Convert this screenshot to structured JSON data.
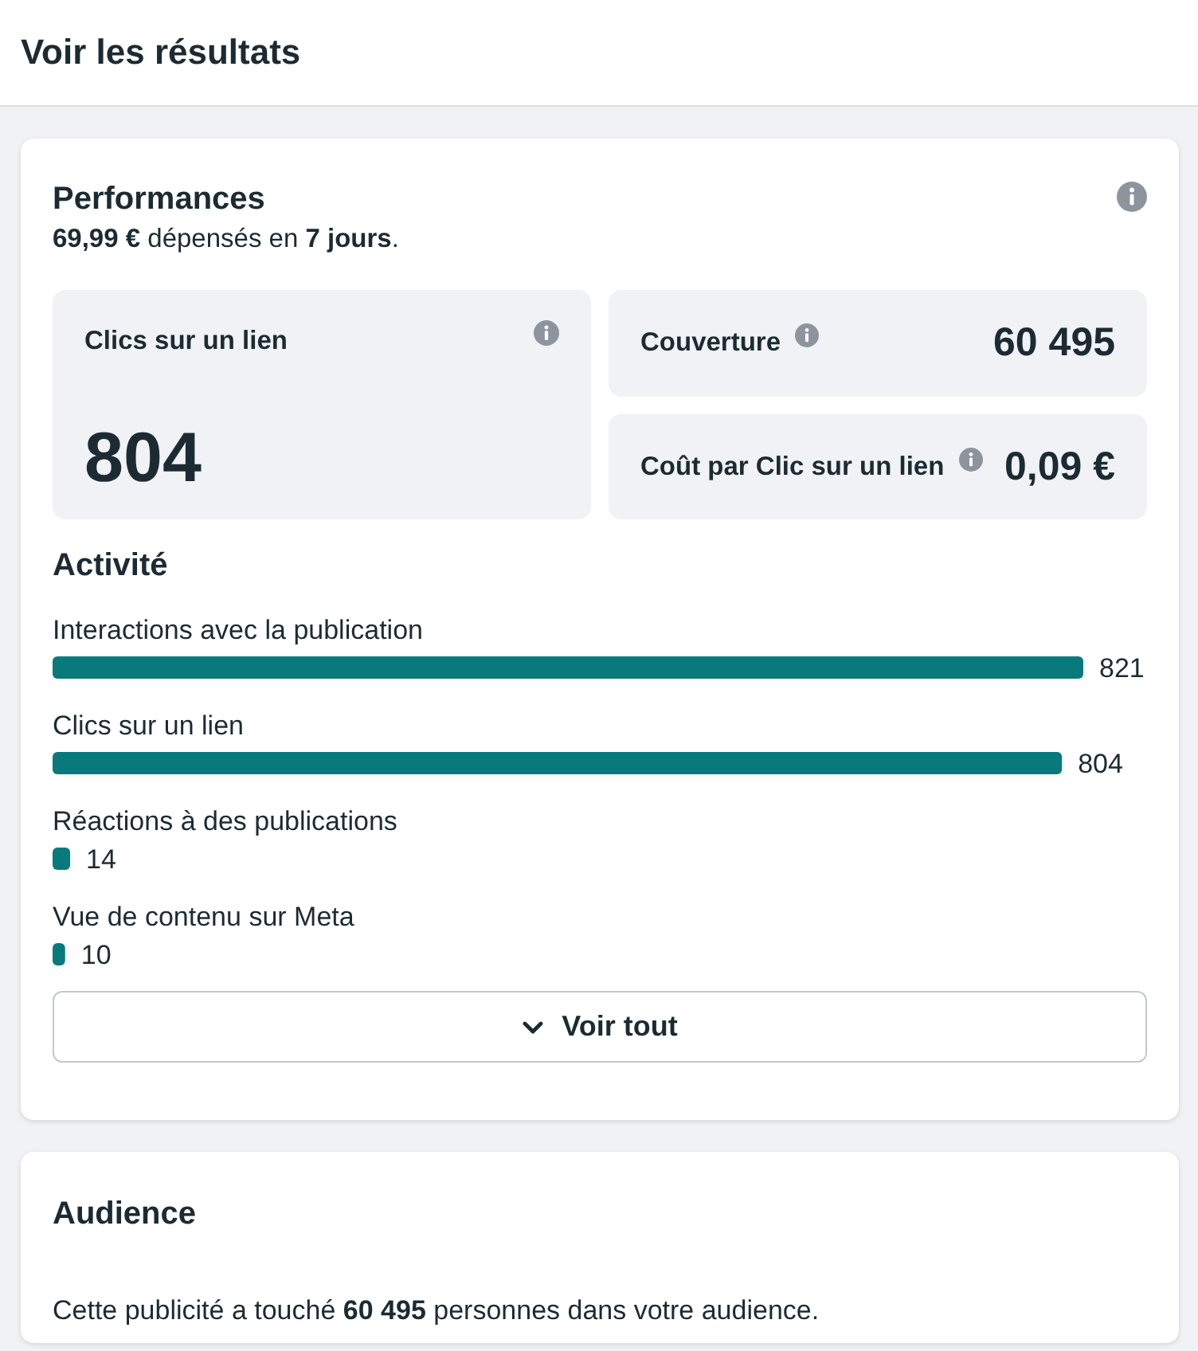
{
  "header": {
    "title": "Voir les résultats"
  },
  "performance": {
    "title": "Performances",
    "summary": "**69,99 €** dépensés en **7 jours**.",
    "metrics": [
      {
        "kind": "large",
        "label": "Clics sur un lien",
        "value": "804"
      },
      {
        "kind": "inline",
        "label": "Couverture",
        "value": "60 495"
      },
      {
        "kind": "inline",
        "label": "Coût par Clic sur un lien",
        "value": "0,09 €"
      }
    ],
    "activity": {
      "title": "Activité",
      "chart_data": {
        "type": "bar",
        "orientation": "horizontal",
        "categories": [
          "Interactions avec la publication",
          "Clics sur un lien",
          "Réactions à des publications",
          "Vue de contenu sur Meta"
        ],
        "values": [
          821,
          804,
          14,
          10
        ],
        "data_labels": true
      }
    },
    "see_all_button": {
      "label": "Voir tout"
    }
  },
  "audience": {
    "title": "Audience",
    "text": "Cette publicité a touché **60 495** personnes dans votre audience."
  }
}
